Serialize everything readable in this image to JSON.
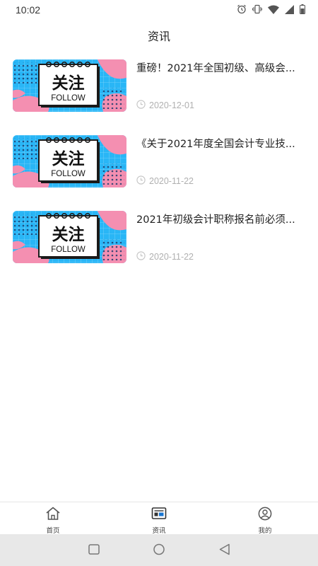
{
  "status_bar": {
    "time": "10:02",
    "icons": [
      "alarm-icon",
      "vibrate-icon",
      "wifi-icon",
      "signal-icon",
      "battery-icon"
    ]
  },
  "header": {
    "title": "资讯"
  },
  "news": [
    {
      "title": "重磅！2021年全国初级、高级会...",
      "date": "2020-12-01",
      "thumb_text_cn": "关注",
      "thumb_text_en": "FOLLOW"
    },
    {
      "title": "《关于2021年度全国会计专业技...",
      "date": "2020-11-22",
      "thumb_text_cn": "关注",
      "thumb_text_en": "FOLLOW"
    },
    {
      "title": "2021年初级会计职称报名前必须...",
      "date": "2020-11-22",
      "thumb_text_cn": "关注",
      "thumb_text_en": "FOLLOW"
    }
  ],
  "tabbar": {
    "items": [
      {
        "label": "首页",
        "icon": "home-icon"
      },
      {
        "label": "资讯",
        "icon": "news-icon",
        "active": true
      },
      {
        "label": "我的",
        "icon": "profile-icon"
      }
    ]
  },
  "colors": {
    "thumb_blue": "#29b6f6",
    "thumb_pink": "#f48fb1",
    "accent_blue": "#1976d2"
  }
}
